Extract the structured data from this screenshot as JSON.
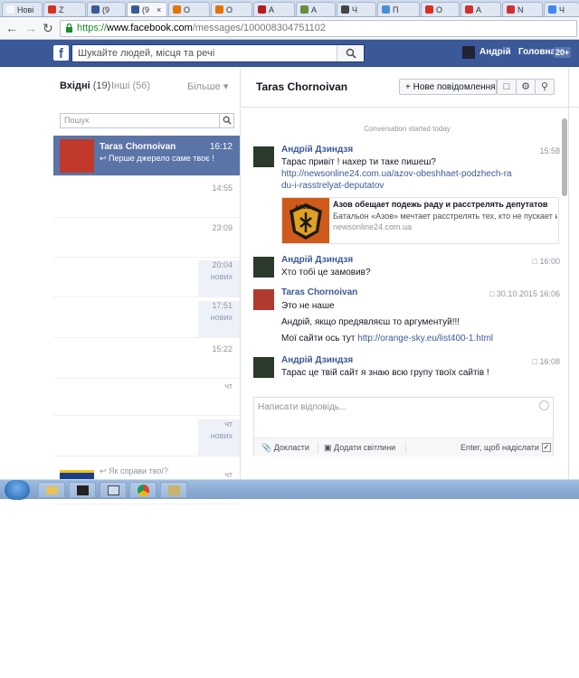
{
  "browser": {
    "tabs": [
      {
        "label": "Нові",
        "color": "#f6f7f9"
      },
      {
        "label": "Z",
        "color": "#d93025"
      },
      {
        "label": "(9",
        "color": "#3b5998"
      },
      {
        "label": "(9",
        "color": "#3b5998"
      },
      {
        "label": "О",
        "color": "#e37400"
      },
      {
        "label": "О",
        "color": "#e37400"
      },
      {
        "label": "А",
        "color": "#b71c1c"
      },
      {
        "label": "А",
        "color": "#6a8c3c"
      },
      {
        "label": "Ч",
        "color": "#444"
      },
      {
        "label": "П",
        "color": "#4a90d9"
      },
      {
        "label": "О",
        "color": "#d93025"
      },
      {
        "label": "А",
        "color": "#d32f2f"
      },
      {
        "label": "N",
        "color": "#d32f2f"
      },
      {
        "label": "Ч",
        "color": "#4285f4"
      }
    ],
    "active_tab_close": "×",
    "url_scheme": "https://",
    "url_host": "www.facebook.com",
    "url_path": "/messages/100008304751102"
  },
  "fb": {
    "logo": "f",
    "search_placeholder": "Шукайте людей, місця та речі",
    "user_name": "Андрій",
    "home_label": "Головна",
    "home_badge": "20+"
  },
  "inbox": {
    "inbox_label": "Вхідні",
    "inbox_count": "(19)",
    "others_label": "Інші",
    "others_count": "(56)",
    "more_label": "Більше",
    "search_placeholder": "Пошук",
    "threads": [
      {
        "name": "Taras Chornoivan",
        "time": "16:12",
        "snippet": "Перше джерело саме твоє !",
        "new": ""
      },
      {
        "name": "",
        "time": "14:55",
        "snippet": "",
        "new": ""
      },
      {
        "name": "",
        "time": "23:09",
        "snippet": "",
        "new": ""
      },
      {
        "name": "",
        "time": "20:04",
        "snippet": "",
        "new": "нових"
      },
      {
        "name": "",
        "time": "17:51",
        "snippet": "",
        "new": "нових"
      },
      {
        "name": "",
        "time": "15:22",
        "snippet": "",
        "new": ""
      },
      {
        "name": "",
        "time": "чт",
        "snippet": "",
        "new": ""
      },
      {
        "name": "",
        "time": "чт",
        "snippet": "",
        "new": "нових"
      },
      {
        "name": "",
        "time": "чт",
        "snippet": "Як справи твої?",
        "new": ""
      }
    ]
  },
  "conversation": {
    "title": "Taras Chornoivan",
    "new_message_label": "Нове повідомлення",
    "started_label": "Conversation started today",
    "messages": [
      {
        "sender": "Андрій Дзиндзя",
        "time": "15:58",
        "lines": [
          "Тарас привіт  ! нахер ти таке пишеш?"
        ],
        "link": "http://newsonline24.com.ua/azov-obeshhaet-podzhech-radu-i-rasstrelyat-deputatov"
      },
      {
        "sender": "Андрій Дзиндзя",
        "time": "16:00",
        "lines": [
          "Хто тобі це замовив?"
        ]
      },
      {
        "sender": "Taras Chornoivan",
        "time": "30.10.2015 16:06",
        "lines": [
          "Это не наше",
          "Андрій, якщо предявляєш то аргументуй!!!",
          "Мої сайти ось тут"
        ],
        "link": "http://orange-sky.eu/list400-1.html"
      },
      {
        "sender": "Андрій Дзиндзя",
        "time": "16:08",
        "lines": [
          "Тарас це твій сайт я знаю всю групу твоїх сайтів !"
        ]
      }
    ],
    "preview": {
      "title": "Азов обещает подежь раду и расстрелять депутатов",
      "desc": "Батальон «Азов» мечтает расстрелять тех, кто не пускает и...",
      "domain": "newsonline24.com.ua",
      "image_label": "АЗОВ"
    }
  },
  "reply": {
    "placeholder": "Написати відповідь...",
    "attach_label": "Докласти",
    "photo_label": "Додати світлини",
    "enter_label": "Enter, щоб надіслати"
  },
  "colors": {
    "fb_blue": "#3b5998",
    "selected_thread": "#5b74a8",
    "link": "#3b5998"
  }
}
